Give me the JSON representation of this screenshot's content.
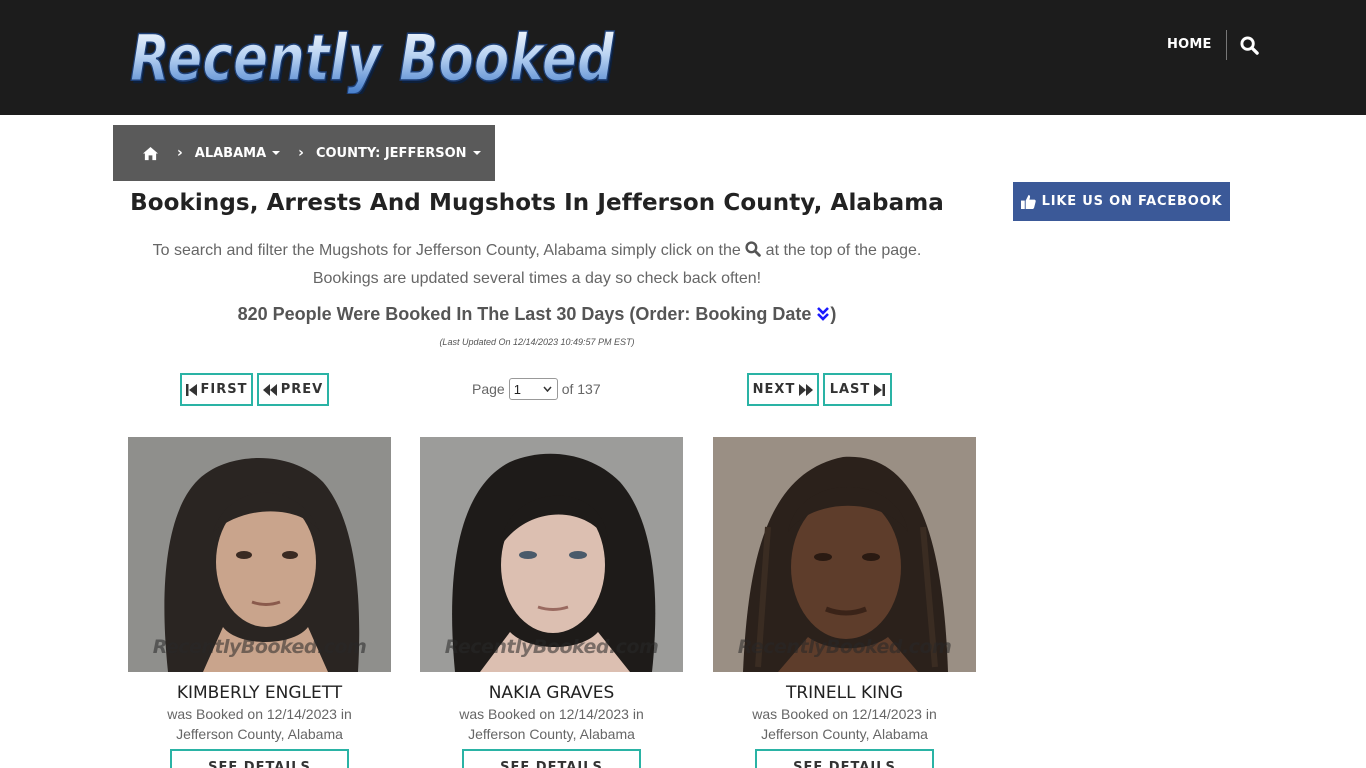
{
  "header": {
    "logo_text": "Recently Booked",
    "nav_home": "HOME"
  },
  "breadcrumb": {
    "state": "ALABAMA",
    "county": "COUNTY: JEFFERSON"
  },
  "main": {
    "title": "Bookings, Arrests And Mugshots In Jefferson County, Alabama",
    "intro_part1": "To search and filter the Mugshots for Jefferson County, Alabama simply click on the",
    "intro_part2": "at the top of the page.",
    "intro_line2": "Bookings are updated several times a day so check back often!",
    "count_text": "820 People Were Booked In The Last 30 Days (Order: Booking Date",
    "count_close": ")",
    "updated": "(Last Updated On 12/14/2023 10:49:57 PM EST)"
  },
  "pager": {
    "first": "FIRST",
    "prev": "PREV",
    "next": "NEXT",
    "last": "LAST",
    "page_label": "Page",
    "page_value": "1",
    "of_label": "of 137"
  },
  "cards": [
    {
      "name": "KIMBERLY ENGLETT",
      "booked_line1": "was Booked on 12/14/2023 in",
      "booked_line2": "Jefferson County, Alabama",
      "watermark": "RecentlyBooked.com",
      "button": "SEE DETAILS"
    },
    {
      "name": "NAKIA GRAVES",
      "booked_line1": "was Booked on 12/14/2023 in",
      "booked_line2": "Jefferson County, Alabama",
      "watermark": "RecentlyBooked.com",
      "button": "SEE DETAILS"
    },
    {
      "name": "TRINELL KING",
      "booked_line1": "was Booked on 12/14/2023 in",
      "booked_line2": "Jefferson County, Alabama",
      "watermark": "RecentlyBooked.com",
      "button": "SEE DETAILS"
    }
  ],
  "sidebar": {
    "facebook_label": "LIKE US ON FACEBOOK"
  },
  "colors": {
    "header_bg": "#1c1c1c",
    "breadcrumb_bg": "#5a5a5a",
    "accent_teal": "#2ab3a5",
    "facebook_blue": "#3b5998",
    "order_icon": "#1a1aff"
  },
  "icons": {
    "search": "search-icon",
    "home": "home-icon",
    "first": "step-backward-icon",
    "prev": "backward-icon",
    "next": "forward-icon",
    "last": "step-forward-icon",
    "order": "double-chevron-down-icon",
    "facebook": "thumbs-up-icon"
  }
}
